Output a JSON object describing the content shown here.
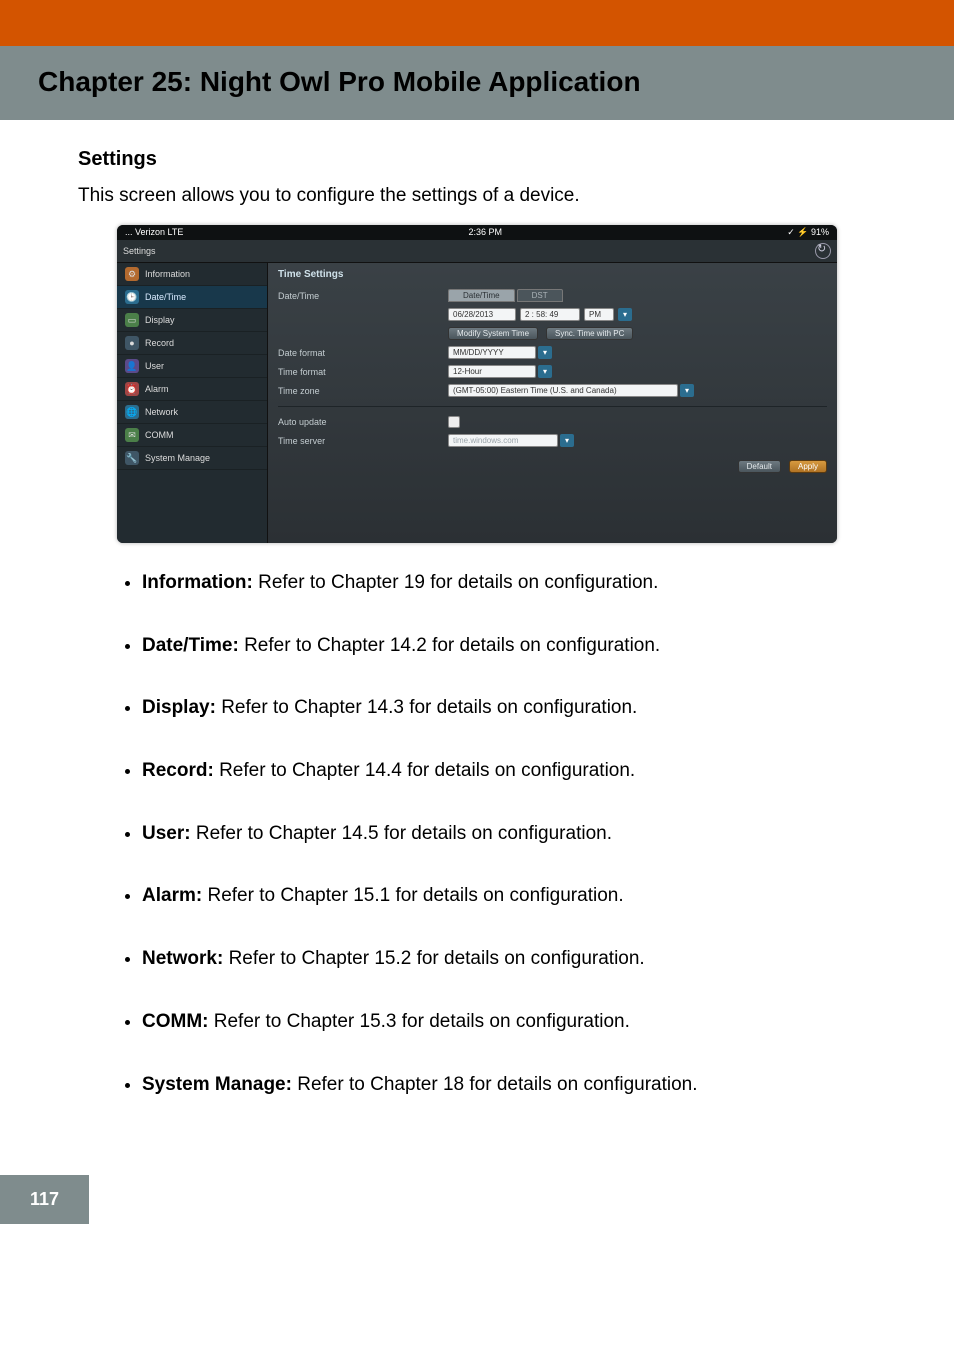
{
  "chapter_title": "Chapter 25: Night Owl Pro Mobile Application",
  "section_heading": "Settings",
  "section_intro": "This screen allows you to configure the settings of a device.",
  "page_number": "117",
  "mock": {
    "statusbar": {
      "carrier": "... Verizon LTE",
      "time": "2:36 PM",
      "battery": "✓ ⚡ 91%"
    },
    "settings_row_label": "Settings",
    "sidebar": [
      {
        "label": "Information",
        "active": false
      },
      {
        "label": "Date/Time",
        "active": true
      },
      {
        "label": "Display",
        "active": false
      },
      {
        "label": "Record",
        "active": false
      },
      {
        "label": "User",
        "active": false
      },
      {
        "label": "Alarm",
        "active": false
      },
      {
        "label": "Network",
        "active": false
      },
      {
        "label": "COMM",
        "active": false
      },
      {
        "label": "System Manage",
        "active": false
      }
    ],
    "panel": {
      "title": "Time Settings",
      "tab_active": "Date/Time",
      "tab_inactive": "DST",
      "date_time_label": "Date/Time",
      "date_value": "06/28/2013",
      "time_value": "2 : 58: 49",
      "ampm": "PM",
      "modify_btn": "Modify System Time",
      "sync_btn": "Sync. Time with PC",
      "date_format_label": "Date format",
      "date_format_value": "MM/DD/YYYY",
      "time_format_label": "Time format",
      "time_format_value": "12-Hour",
      "time_zone_label": "Time zone",
      "time_zone_value": "(GMT-05:00) Eastern Time (U.S. and Canada)",
      "auto_update_label": "Auto update",
      "time_server_label": "Time server",
      "time_server_value": "time.windows.com",
      "default_btn": "Default",
      "apply_btn": "Apply"
    }
  },
  "bullets": [
    {
      "term": "Information:",
      "text": " Refer to Chapter 19 for details on configuration."
    },
    {
      "term": "Date/Time:",
      "text": " Refer to Chapter 14.2 for details on configuration."
    },
    {
      "term": "Display:",
      "text": " Refer to Chapter 14.3 for details on configuration."
    },
    {
      "term": "Record:",
      "text": " Refer to Chapter 14.4 for details on configuration."
    },
    {
      "term": "User:",
      "text": " Refer to Chapter 14.5 for details on configuration."
    },
    {
      "term": "Alarm:",
      "text": " Refer to Chapter 15.1 for details on configuration."
    },
    {
      "term": "Network:",
      "text": " Refer to Chapter 15.2 for details on configuration."
    },
    {
      "term": "COMM:",
      "text": " Refer to Chapter 15.3 for details on configuration."
    },
    {
      "term": "System Manage:",
      "text": " Refer to Chapter 18 for details on configuration."
    }
  ]
}
